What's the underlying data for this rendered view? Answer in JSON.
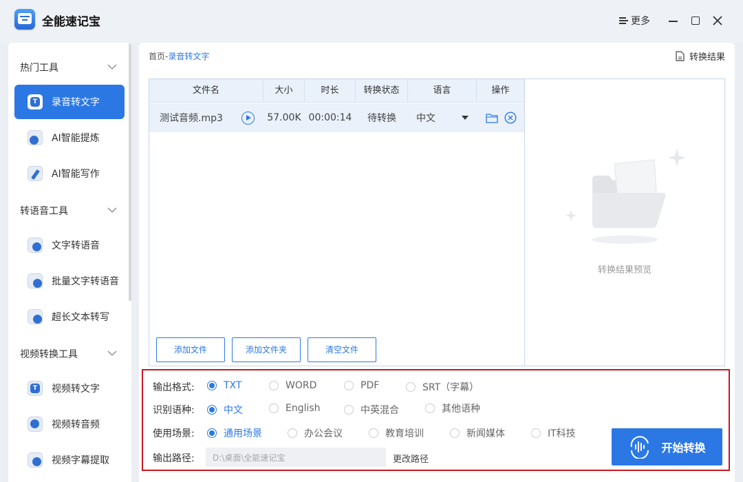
{
  "app": {
    "title": "全能速记宝",
    "more_label": "更多"
  },
  "colors": {
    "accent": "#2b78e4",
    "highlight_border": "#c8161e"
  },
  "sidebar": {
    "groups": [
      {
        "label": "热门工具",
        "items": [
          "录音转文字",
          "AI智能提炼",
          "AI智能写作"
        ]
      },
      {
        "label": "转语音工具",
        "items": [
          "文字转语音",
          "批量文字转语音",
          "超长文本转写"
        ]
      },
      {
        "label": "视频转换工具",
        "items": [
          "视频转文字",
          "视频转音频",
          "视频字幕提取"
        ]
      }
    ],
    "active_item": "录音转文字"
  },
  "breadcrumb": {
    "home": "首页",
    "sep": "-",
    "current": "录音转文字"
  },
  "result_link": "转换结果",
  "table": {
    "headers": [
      "文件名",
      "大小",
      "时长",
      "转换状态",
      "语言",
      "操作"
    ],
    "rows": [
      {
        "name": "测试音频.mp3",
        "size": "57.00K",
        "duration": "00:00:14",
        "status": "待转换",
        "language": "中文"
      }
    ]
  },
  "file_buttons": [
    "添加文件",
    "添加文件夹",
    "清空文件"
  ],
  "preview": {
    "placeholder": "转换结果预览"
  },
  "settings": {
    "format": {
      "label": "输出格式:",
      "options": [
        "TXT",
        "WORD",
        "PDF",
        "SRT（字幕）"
      ],
      "selected": "TXT"
    },
    "language": {
      "label": "识别语种:",
      "options": [
        "中文",
        "English",
        "中英混合",
        "其他语种"
      ],
      "selected": "中文"
    },
    "scene": {
      "label": "使用场景:",
      "options": [
        "通用场景",
        "办公会议",
        "教育培训",
        "新闻媒体",
        "IT科技"
      ],
      "selected": "通用场景"
    },
    "path": {
      "label": "输出路径:",
      "value": "D:\\桌面\\全能速记宝",
      "change_label": "更改路径"
    }
  },
  "start_button": "开始转换"
}
